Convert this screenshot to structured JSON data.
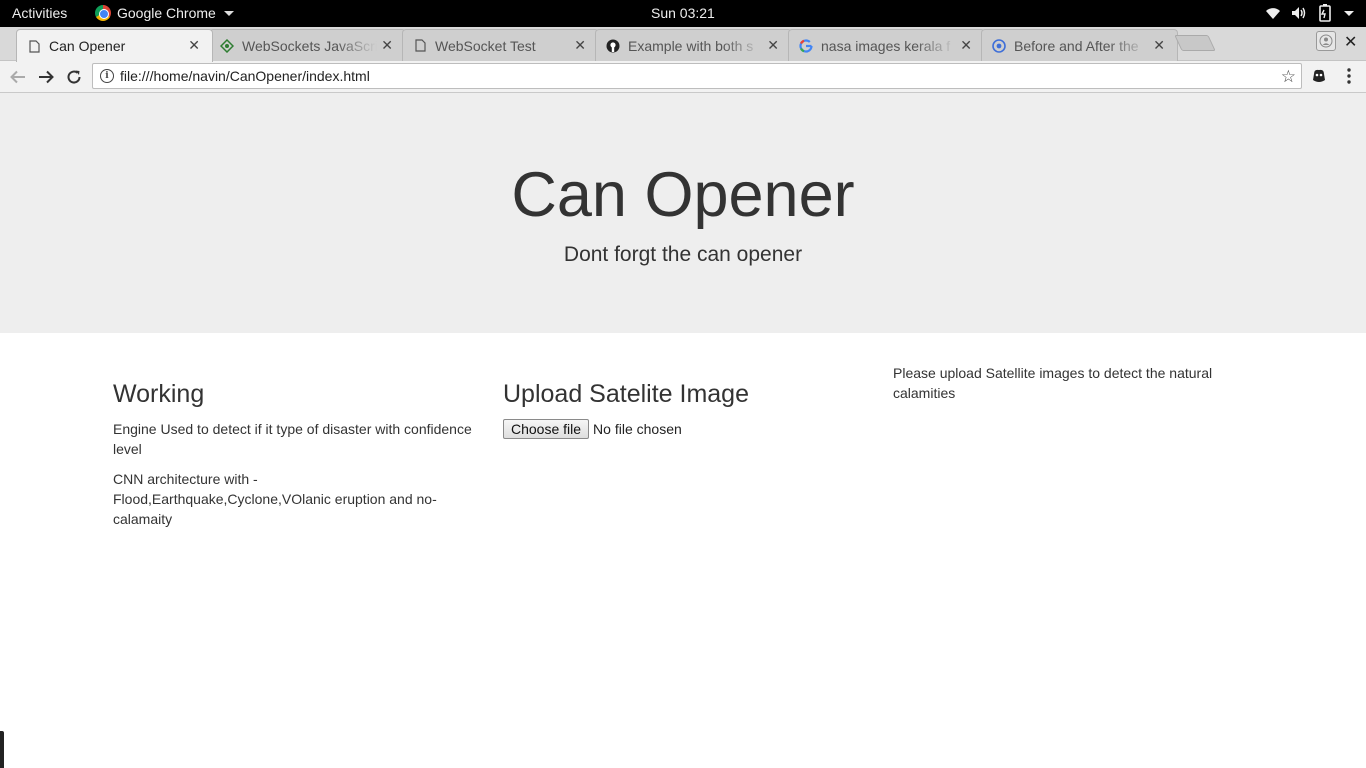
{
  "system_bar": {
    "activities": "Activities",
    "app_name": "Google Chrome",
    "clock": "Sun 03:21",
    "icons": [
      "wifi-icon",
      "volume-icon",
      "battery-icon",
      "power-menu-icon"
    ]
  },
  "tabs": [
    {
      "title": "Can Opener",
      "favicon": "page-icon",
      "active": true
    },
    {
      "title": "WebSockets JavaScript",
      "favicon": "websocket-icon",
      "active": false
    },
    {
      "title": "WebSocket Test",
      "favicon": "page-icon",
      "active": false
    },
    {
      "title": "Example with both s",
      "favicon": "github-icon",
      "active": false
    },
    {
      "title": "nasa images kerala f",
      "favicon": "google-icon",
      "active": false
    },
    {
      "title": "Before and After the",
      "favicon": "web-icon",
      "active": false
    }
  ],
  "toolbar": {
    "url": "file:///home/navin/CanOpener/index.html",
    "info_glyph": "i",
    "star_glyph": "☆"
  },
  "page": {
    "title": "Can Opener",
    "subtitle": "Dont forgt the can opener",
    "working": {
      "heading": "Working",
      "para1": "Engine Used to detect if it type of disaster with confidence level",
      "para2": "CNN architecture with - Flood,Earthquake,Cyclone,VOlanic eruption and no-calamaity"
    },
    "upload": {
      "heading": "Upload Satelite Image",
      "button_label": "Choose file",
      "status": "No file chosen"
    },
    "note": "Please upload Satellite images to detect the natural calamities"
  }
}
